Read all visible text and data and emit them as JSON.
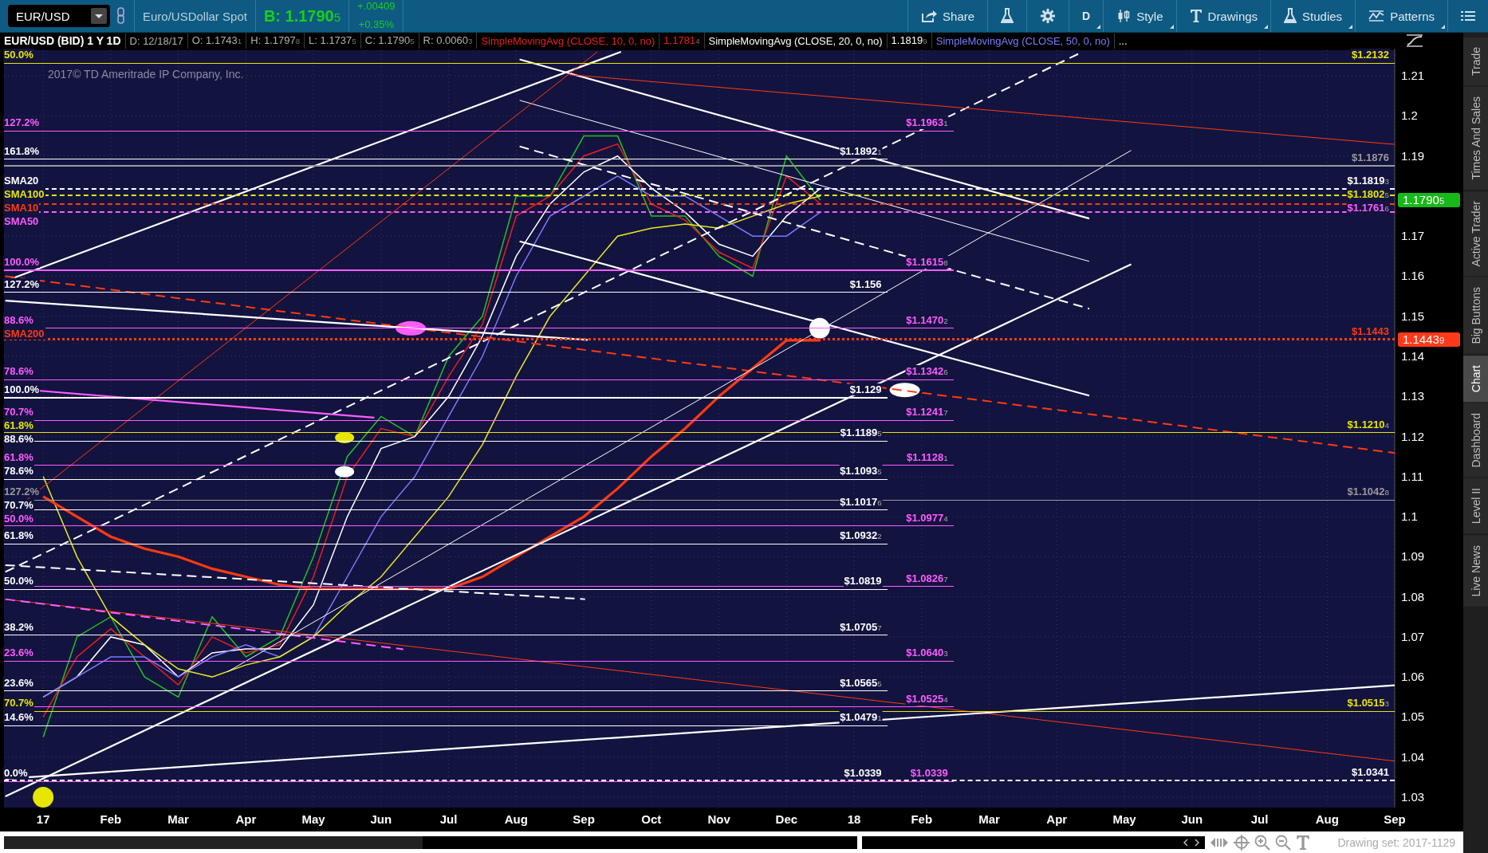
{
  "toolbar": {
    "symbol": "EUR/USD",
    "description": "Euro/USDollar Spot",
    "bid": "B: 1.1790",
    "bid_pip": "5",
    "change": "+.00409",
    "change_pct": "+0.35%",
    "buttons": [
      {
        "kind": "share",
        "label": "Share",
        "dropdown": false
      },
      {
        "kind": "flask",
        "dropdown": false
      },
      {
        "kind": "gear",
        "dropdown": false
      },
      {
        "kind": "text",
        "label": "D",
        "dropdown": true
      },
      {
        "kind": "style",
        "label": "Style",
        "dropdown": true
      },
      {
        "kind": "drawings",
        "label": "Drawings",
        "dropdown": true
      },
      {
        "kind": "studies",
        "label": "Studies",
        "dropdown": true
      },
      {
        "kind": "patterns",
        "label": "Patterns",
        "dropdown": true
      },
      {
        "kind": "menu",
        "dropdown": false
      }
    ]
  },
  "info_bar": {
    "fields": [
      {
        "text": "D: 12/18/17"
      },
      {
        "text": "O: 1.1743",
        "pip": "1"
      },
      {
        "text": "H: 1.1797",
        "pip": "8"
      },
      {
        "text": "L: 1.1737",
        "pip": "5"
      },
      {
        "text": "C: 1.1790",
        "pip": "5"
      },
      {
        "text": "R: 0.0060",
        "pip": "3"
      }
    ],
    "studies": [
      {
        "text": "SimpleMovingAvg (CLOSE, 10, 0, no)",
        "color": "#e8201a",
        "value": "1.1781",
        "pip": "4"
      },
      {
        "text": "SimpleMovingAvg (CLOSE, 20, 0, no)",
        "color": "#ffffff",
        "value": "1.1819",
        "pip": "9"
      },
      {
        "text": "SimpleMovingAvg (CLOSE, 50, 0, no)",
        "color": "#7a7aff"
      }
    ],
    "more": "..."
  },
  "chart": {
    "copyright": "2017© TD Ameritrade IP Company, Inc.",
    "chart_data": {
      "type": "line",
      "title": "EUR/USD (BID) 1 Y 1D",
      "categories": [
        "17",
        null,
        "Feb",
        null,
        "Mar",
        null,
        "Apr",
        null,
        "May",
        null,
        "Jun",
        null,
        "Jul",
        null,
        "Aug",
        null,
        "Sep",
        null,
        "Oct",
        null,
        "Nov",
        null,
        "Dec",
        null,
        "18",
        null,
        "Feb",
        null,
        "Mar",
        null,
        "Apr",
        null,
        "May",
        null,
        "Jun",
        null,
        "Jul",
        null,
        "Aug",
        null,
        "Sep"
      ],
      "series": [
        {
          "color": "#22c022",
          "values": [
            1.045,
            1.07,
            1.075,
            1.06,
            1.055,
            1.075,
            1.065,
            1.07,
            1.09,
            1.115,
            1.125,
            1.12,
            1.14,
            1.15,
            1.18,
            1.18,
            1.195,
            1.195,
            1.175,
            1.175,
            1.165,
            1.16,
            1.19,
            1.179,
            null,
            null,
            null,
            null,
            null,
            null,
            null,
            null,
            null,
            null,
            null,
            null,
            null,
            null,
            null,
            null,
            null
          ]
        },
        {
          "color": "#e8201a",
          "values": [
            1.05,
            1.065,
            1.072,
            1.065,
            1.058,
            1.07,
            1.066,
            1.068,
            1.085,
            1.11,
            1.122,
            1.12,
            1.135,
            1.148,
            1.175,
            1.18,
            1.19,
            1.193,
            1.178,
            1.174,
            1.166,
            1.162,
            1.185,
            1.1781,
            null,
            null,
            null,
            null,
            null,
            null,
            null,
            null,
            null,
            null,
            null,
            null,
            null,
            null,
            null,
            null,
            null
          ]
        },
        {
          "color": "#ffffff",
          "values": [
            1.055,
            1.06,
            1.07,
            1.068,
            1.06,
            1.066,
            1.067,
            1.067,
            1.078,
            1.1,
            1.117,
            1.12,
            1.13,
            1.145,
            1.165,
            1.178,
            1.186,
            1.19,
            1.182,
            1.176,
            1.168,
            1.165,
            1.175,
            1.1819,
            null,
            null,
            null,
            null,
            null,
            null,
            null,
            null,
            null,
            null,
            null,
            null,
            null,
            null,
            null,
            null,
            null
          ]
        },
        {
          "color": "#7a7aff",
          "values": [
            1.055,
            1.06,
            1.065,
            1.065,
            1.06,
            1.065,
            1.068,
            1.065,
            1.07,
            1.085,
            1.1,
            1.11,
            1.125,
            1.14,
            1.16,
            1.175,
            1.18,
            1.185,
            1.18,
            1.18,
            1.175,
            1.17,
            1.17,
            1.176,
            null,
            null,
            null,
            null,
            null,
            null,
            null,
            null,
            null,
            null,
            null,
            null,
            null,
            null,
            null,
            null,
            null
          ]
        },
        {
          "color": "#e8e820",
          "values": [
            1.11,
            1.09,
            1.075,
            1.068,
            1.062,
            1.06,
            1.063,
            1.065,
            1.07,
            1.078,
            1.085,
            1.095,
            1.105,
            1.118,
            1.135,
            1.15,
            1.16,
            1.17,
            1.172,
            1.173,
            1.172,
            1.175,
            1.178,
            1.18,
            null,
            null,
            null,
            null,
            null,
            null,
            null,
            null,
            null,
            null,
            null,
            null,
            null,
            null,
            null,
            null,
            null
          ]
        },
        {
          "color": "#ff3a10",
          "values": [
            1.105,
            1.1,
            1.095,
            1.092,
            1.09,
            1.087,
            1.085,
            1.083,
            1.082,
            1.082,
            1.082,
            1.082,
            1.082,
            1.085,
            1.09,
            1.095,
            1.1,
            1.107,
            1.115,
            1.122,
            1.13,
            1.137,
            1.144,
            1.144,
            null,
            null,
            null,
            null,
            null,
            null,
            null,
            null,
            null,
            null,
            null,
            null,
            null,
            null,
            null,
            null,
            null
          ]
        }
      ],
      "ylim": [
        1.0274,
        1.2164
      ],
      "yticks": [
        1.03,
        1.04,
        1.05,
        1.06,
        1.07,
        1.08,
        1.09,
        1.1,
        1.11,
        1.12,
        1.13,
        1.14,
        1.15,
        1.16,
        1.17,
        1.19,
        1.2,
        1.21
      ],
      "grid": true
    },
    "levels": [
      {
        "tag": "50.0%",
        "label": "$1.2132",
        "color": "#e6e600"
      },
      {
        "tag": "127.2%",
        "label": "$1.1963",
        "pip": "1",
        "color": "#ff5cff"
      },
      {
        "tag": "161.8%",
        "label": "$1.1892",
        "pip": "1",
        "color": "#ffffff"
      },
      {
        "label": "$1.1876",
        "color": "#9a9a9a"
      },
      {
        "tag": "SMA20",
        "label": "$1.1819",
        "pip": "3",
        "color": "#ffffff"
      },
      {
        "tag": "SMA100",
        "label": "$1.1802",
        "pip": "5",
        "color": "#e6e600"
      },
      {
        "tag": "SMA10",
        "color": "#ff3a10"
      },
      {
        "tag": "SMA50",
        "label": "$1.1761",
        "pip": "6",
        "color": "#ff5cff"
      },
      {
        "tag": "100.0%",
        "label": "$1.1615",
        "pip": "8",
        "color": "#ff5cff"
      },
      {
        "tag": "127.2%",
        "label": "$1.156",
        "color": "#ffffff"
      },
      {
        "tag": "88.6%",
        "label": "$1.1470",
        "pip": "2",
        "color": "#ff5cff"
      },
      {
        "tag": "SMA200",
        "label": "$1.1443",
        "color": "#ff3a10"
      },
      {
        "tag": "78.6%",
        "label": "$1.1342",
        "pip": "6",
        "color": "#ff5cff"
      },
      {
        "tag": "100.0%",
        "label": "$1.129",
        "color": "#ffffff"
      },
      {
        "tag": "70.7%",
        "label": "$1.1241",
        "pip": "7",
        "color": "#ff5cff"
      },
      {
        "tag": "61.8%",
        "label": "$1.1210",
        "pip": "4",
        "color": "#e6e600"
      },
      {
        "tag": "88.6%",
        "label": "$1.1189",
        "pip": "5",
        "color": "#ffffff"
      },
      {
        "tag": "61.8%",
        "label": "$1.1128",
        "pip": "1",
        "color": "#ff5cff"
      },
      {
        "tag": "78.6%",
        "label": "$1.1093",
        "pip": "5",
        "color": "#ffffff"
      },
      {
        "tag": "127.2%",
        "label": "$1.1042",
        "pip": "8",
        "color": "#9a9a9a"
      },
      {
        "tag": "70.7%",
        "label": "$1.1017",
        "pip": "6",
        "color": "#ffffff"
      },
      {
        "tag": "50.0%",
        "label": "$1.0977",
        "pip": "4",
        "color": "#ff5cff"
      },
      {
        "tag": "61.8%",
        "label": "$1.0932",
        "pip": "2",
        "color": "#ffffff"
      },
      {
        "tag": "50.0%",
        "label": "$1.0819",
        "color": "#ffffff"
      },
      {
        "label": "$1.0826",
        "pip": "7",
        "color": "#ff5cff"
      },
      {
        "tag": "38.2%",
        "label": "$1.0705",
        "pip": "7",
        "color": "#ffffff"
      },
      {
        "tag": "23.6%",
        "label": "$1.0640",
        "pip": "3",
        "color": "#ff5cff"
      },
      {
        "tag": "23.6%",
        "label": "$1.0565",
        "pip": "5",
        "color": "#ffffff"
      },
      {
        "tag": "70.7%",
        "label": "$1.0515",
        "pip": "3",
        "color": "#e6e600"
      },
      {
        "label": "$1.0525",
        "pip": "4",
        "color": "#ff5cff"
      },
      {
        "tag": "14.6%",
        "label": "$1.0479",
        "pip": "1",
        "color": "#ffffff"
      },
      {
        "tag": "0.0%",
        "label": "$1.0339",
        "color": "#ffffff"
      },
      {
        "label": "$1.0339",
        "color": "#ff5cff"
      },
      {
        "label": "$1.0341",
        "color": "#ffffff"
      }
    ],
    "badges": [
      {
        "text": "1.1790",
        "pip": "5",
        "color": "#18b818"
      },
      {
        "text": "1.1443",
        "pip": "9",
        "color": "#ff3a1a"
      }
    ]
  },
  "sidebar": {
    "tabs": [
      {
        "label": "Trade",
        "selected": false
      },
      {
        "label": "Times And Sales",
        "selected": false
      },
      {
        "label": "Active Trader",
        "selected": false
      },
      {
        "label": "Big Buttons",
        "selected": false
      },
      {
        "label": "Chart",
        "selected": true
      },
      {
        "label": "Dashboard",
        "selected": false
      },
      {
        "label": "Level II",
        "selected": false
      },
      {
        "label": "Live News",
        "selected": false
      }
    ]
  },
  "footer": {
    "drawing_set": "Drawing set: 2017-1129"
  }
}
